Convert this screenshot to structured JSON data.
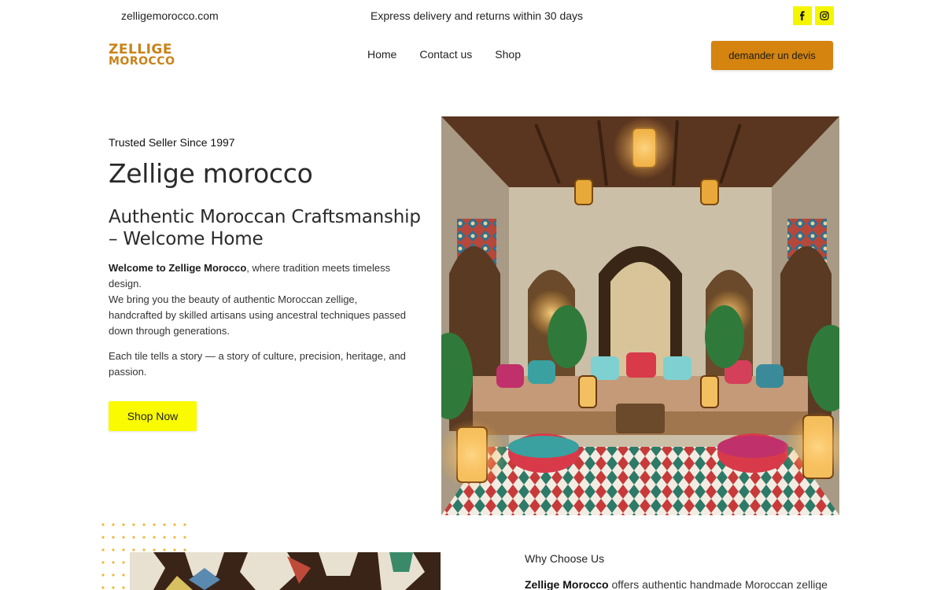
{
  "topbar": {
    "domain": "zelligemorocco.com",
    "promo": "Express delivery and returns within 30 days",
    "social": [
      "facebook-icon",
      "instagram-icon"
    ]
  },
  "header": {
    "logo_line1": "ZELLIGE",
    "logo_line2": "MOROCCO",
    "nav": [
      "Home",
      "Contact us",
      "Shop"
    ],
    "cta_label": "demander un devis"
  },
  "hero": {
    "eyebrow": "Trusted Seller Since 1997",
    "title": "Zellige morocco",
    "subtitle": "Authentic Moroccan Craftsmanship – Welcome Home",
    "p1_bold": "Welcome to Zellige Morocco",
    "p1_rest": ", where tradition meets timeless design.",
    "p1_line2": "We bring you the beauty of authentic Moroccan zellige, handcrafted by skilled artisans using ancestral techniques passed down through generations.",
    "p2": "Each tile tells a story — a story of culture, precision, heritage, and passion.",
    "button": "Shop Now"
  },
  "why": {
    "heading": "Why Choose Us",
    "text_bold": "Zellige Morocco",
    "text_rest": " offers authentic handmade Moroccan zellige"
  },
  "colors": {
    "accent_orange": "#d4840f",
    "logo_gold": "#c98218",
    "yellow": "#fafa00"
  }
}
